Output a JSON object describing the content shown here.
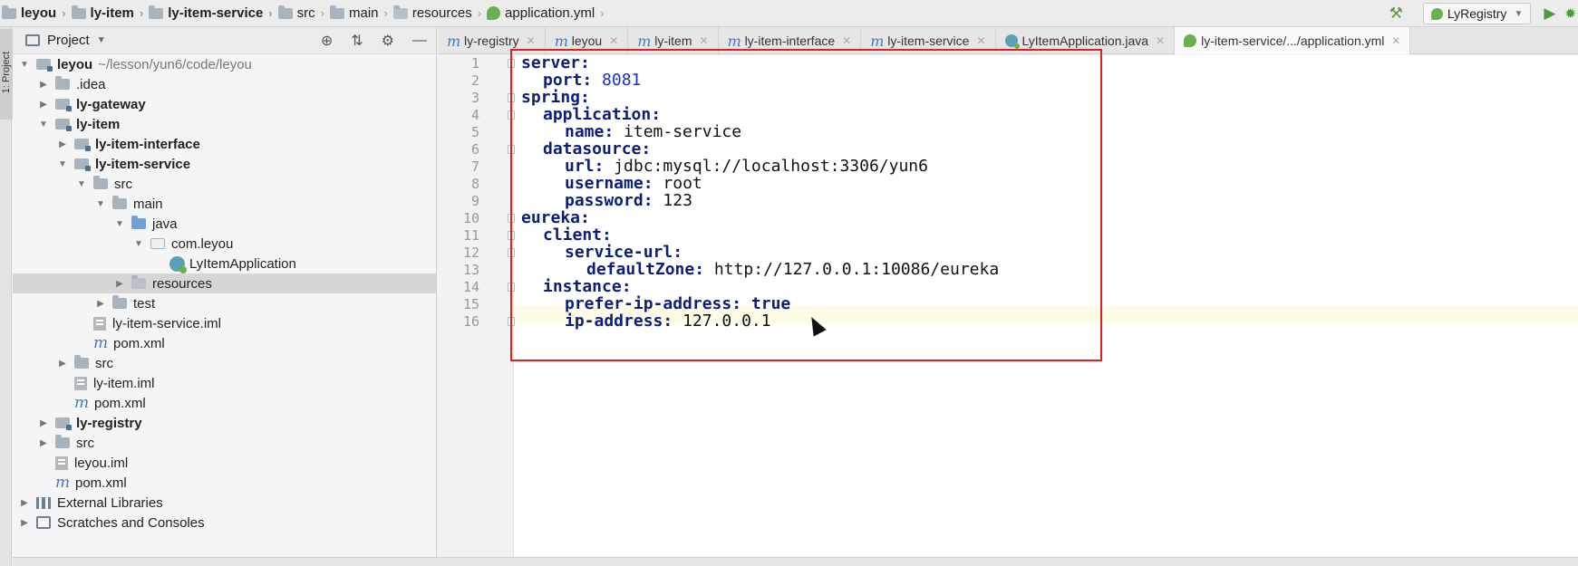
{
  "breadcrumbs": [
    "leyou",
    "ly-item",
    "ly-item-service",
    "src",
    "main",
    "resources",
    "application.yml"
  ],
  "toolbar": {
    "run_config": "LyRegistry"
  },
  "toolstrip": {
    "project_tab": "1: Project"
  },
  "project_panel": {
    "title": "Project",
    "root_path": "~/lesson/yun6/code/leyou",
    "tree": [
      {
        "label": "leyou",
        "depth": 0,
        "icon": "module-folder-icon",
        "expanded": true,
        "bold": true
      },
      {
        "label": ".idea",
        "depth": 1,
        "icon": "folder-icon",
        "expanded": false
      },
      {
        "label": "ly-gateway",
        "depth": 1,
        "icon": "module-folder-icon",
        "expanded": false,
        "bold": true
      },
      {
        "label": "ly-item",
        "depth": 1,
        "icon": "module-folder-icon",
        "expanded": true,
        "bold": true
      },
      {
        "label": "ly-item-interface",
        "depth": 2,
        "icon": "module-folder-icon",
        "expanded": false,
        "bold": true
      },
      {
        "label": "ly-item-service",
        "depth": 2,
        "icon": "module-folder-icon",
        "expanded": true,
        "bold": true
      },
      {
        "label": "src",
        "depth": 3,
        "icon": "folder-icon",
        "expanded": true
      },
      {
        "label": "main",
        "depth": 4,
        "icon": "folder-icon",
        "expanded": true
      },
      {
        "label": "java",
        "depth": 5,
        "icon": "source-folder-icon",
        "expanded": true
      },
      {
        "label": "com.leyou",
        "depth": 6,
        "icon": "package-icon",
        "expanded": true
      },
      {
        "label": "LyItemApplication",
        "depth": 7,
        "icon": "spring-class-icon"
      },
      {
        "label": "resources",
        "depth": 5,
        "icon": "resources-folder-icon",
        "expanded": false,
        "selected": true
      },
      {
        "label": "test",
        "depth": 4,
        "icon": "folder-icon",
        "expanded": false
      },
      {
        "label": "ly-item-service.iml",
        "depth": 3,
        "icon": "iml-file-icon"
      },
      {
        "label": "pom.xml",
        "depth": 3,
        "icon": "maven-icon"
      },
      {
        "label": "src",
        "depth": 2,
        "icon": "folder-icon",
        "expanded": false
      },
      {
        "label": "ly-item.iml",
        "depth": 2,
        "icon": "iml-file-icon"
      },
      {
        "label": "pom.xml",
        "depth": 2,
        "icon": "maven-icon"
      },
      {
        "label": "ly-registry",
        "depth": 1,
        "icon": "module-folder-icon",
        "expanded": false,
        "bold": true
      },
      {
        "label": "src",
        "depth": 1,
        "icon": "folder-icon",
        "expanded": false
      },
      {
        "label": "leyou.iml",
        "depth": 1,
        "icon": "iml-file-icon"
      },
      {
        "label": "pom.xml",
        "depth": 1,
        "icon": "maven-icon"
      },
      {
        "label": "External Libraries",
        "depth": 0,
        "icon": "library-icon",
        "expanded": false
      },
      {
        "label": "Scratches and Consoles",
        "depth": 0,
        "icon": "scratches-icon",
        "expanded": false
      }
    ]
  },
  "tabs": [
    {
      "label": "ly-registry",
      "icon": "maven-icon",
      "active": false
    },
    {
      "label": "leyou",
      "icon": "maven-icon",
      "active": false
    },
    {
      "label": "ly-item",
      "icon": "maven-icon",
      "active": false
    },
    {
      "label": "ly-item-interface",
      "icon": "maven-icon",
      "active": false
    },
    {
      "label": "ly-item-service",
      "icon": "maven-icon",
      "active": false
    },
    {
      "label": "LyItemApplication.java",
      "icon": "spring-class-icon",
      "active": false
    },
    {
      "label": "ly-item-service/.../application.yml",
      "icon": "yaml-spring-icon",
      "active": true
    }
  ],
  "editor": {
    "lines": [
      {
        "num": "1",
        "indent": 0,
        "key": "server:",
        "value": "",
        "vtype": ""
      },
      {
        "num": "2",
        "indent": 1,
        "key": "port:",
        "value": "8081",
        "vtype": "num"
      },
      {
        "num": "3",
        "indent": 0,
        "key": "spring:",
        "value": "",
        "vtype": ""
      },
      {
        "num": "4",
        "indent": 1,
        "key": "application:",
        "value": "",
        "vtype": ""
      },
      {
        "num": "5",
        "indent": 2,
        "key": "name:",
        "value": "item-service",
        "vtype": "str"
      },
      {
        "num": "6",
        "indent": 1,
        "key": "datasource:",
        "value": "",
        "vtype": ""
      },
      {
        "num": "7",
        "indent": 2,
        "key": "url:",
        "value": "jdbc:mysql://localhost:3306/yun6",
        "vtype": "str"
      },
      {
        "num": "8",
        "indent": 2,
        "key": "username:",
        "value": "root",
        "vtype": "str"
      },
      {
        "num": "9",
        "indent": 2,
        "key": "password:",
        "value": "123",
        "vtype": "str"
      },
      {
        "num": "10",
        "indent": 0,
        "key": "eureka:",
        "value": "",
        "vtype": ""
      },
      {
        "num": "11",
        "indent": 1,
        "key": "client:",
        "value": "",
        "vtype": ""
      },
      {
        "num": "12",
        "indent": 2,
        "key": "service-url:",
        "value": "",
        "vtype": ""
      },
      {
        "num": "13",
        "indent": 3,
        "key": "defaultZone:",
        "value": "http://127.0.0.1:10086/eureka",
        "vtype": "str"
      },
      {
        "num": "14",
        "indent": 1,
        "key": "instance:",
        "value": "",
        "vtype": ""
      },
      {
        "num": "15",
        "indent": 2,
        "key": "prefer-ip-address:",
        "value": "true",
        "vtype": "kw"
      },
      {
        "num": "16",
        "indent": 2,
        "key": "ip-address:",
        "value": "127.0.0.1",
        "vtype": "str"
      }
    ],
    "highlight_color": "#e02020"
  },
  "colors": {
    "yaml_key": "#0b1f7a",
    "number": "#1a2fcf",
    "selection": "#d6d6d6"
  }
}
